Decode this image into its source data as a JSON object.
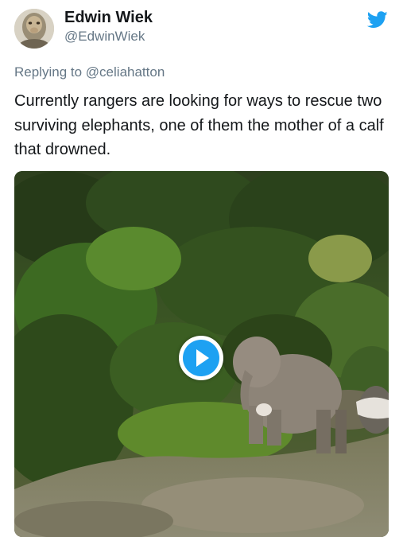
{
  "author": {
    "display_name": "Edwin Wiek",
    "handle": "@EdwinWiek",
    "avatar_icon": "avatar-photo-icon"
  },
  "brand": {
    "icon": "twitter-bird-icon",
    "color": "#1da1f2"
  },
  "reply_context": {
    "prefix": "Replying to",
    "mention": "@celiahatton"
  },
  "tweet": {
    "text": "Currently rangers are looking for ways to rescue two surviving elephants, one of them the mother of a calf that drowned."
  },
  "media": {
    "type": "video",
    "play_icon": "play-icon",
    "play_color": "#1da1f2"
  },
  "colors": {
    "text_primary": "#14171a",
    "text_secondary": "#657786"
  }
}
